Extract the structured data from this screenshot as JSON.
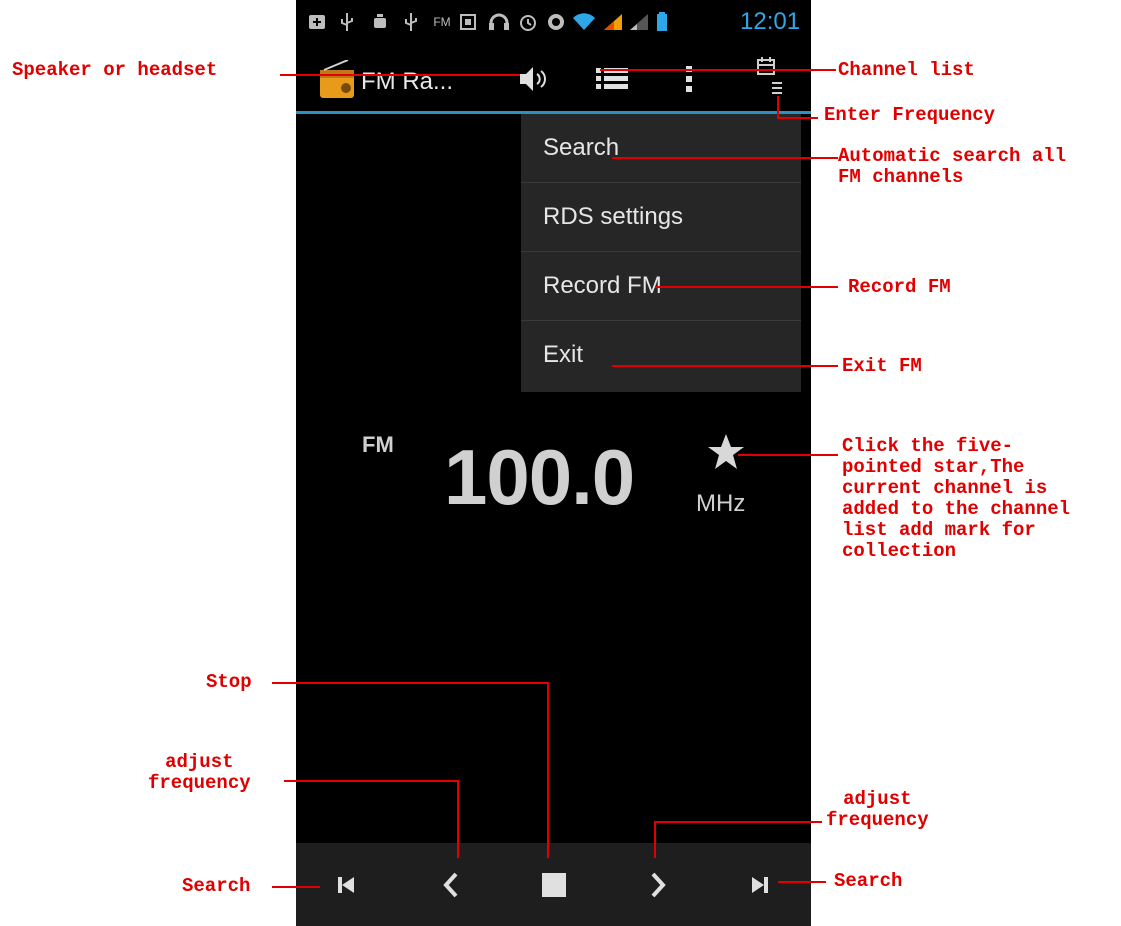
{
  "status_bar": {
    "fm_label": "FM",
    "time": "12:01"
  },
  "action_bar": {
    "app_title": "FM Ra..."
  },
  "menu": {
    "items": [
      {
        "label": "Search"
      },
      {
        "label": "RDS settings"
      },
      {
        "label": "Record FM"
      },
      {
        "label": "Exit"
      }
    ]
  },
  "tuner": {
    "band": "FM",
    "frequency": "100.0",
    "unit": "MHz"
  },
  "annotations": {
    "speaker": "Speaker or headset",
    "channel_list": "Channel list",
    "enter_frequency": "Enter Frequency",
    "auto_search": "Automatic search all\nFM channels",
    "record": "Record FM",
    "exit": "Exit FM",
    "star": "Click the five-\npointed star,The\ncurrent channel is\nadded to the channel\nlist add mark for\ncollection",
    "stop": "Stop",
    "adjust_left": "adjust\nfrequency",
    "adjust_right": "adjust\nfrequency",
    "search_left": "Search",
    "search_right": "Search"
  },
  "colors": {
    "accent": "#2e8fc2",
    "annotation": "#e00000",
    "time": "#2ea7e8"
  }
}
